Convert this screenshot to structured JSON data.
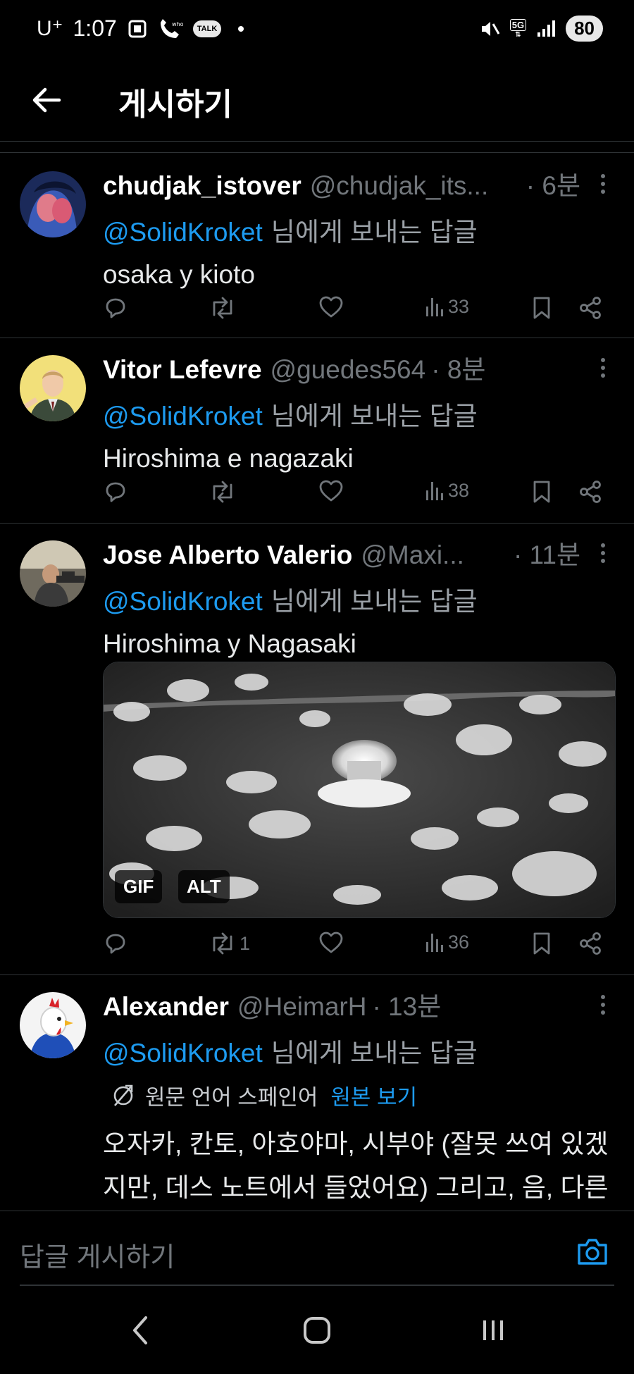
{
  "status_bar": {
    "carrier": "U⁺",
    "time": "1:07",
    "talk_label": "TALK",
    "network": "5G",
    "battery": "80"
  },
  "header": {
    "title": "게시하기"
  },
  "tweets": [
    {
      "name": "chudjak_istover",
      "handle": "@chudjak_its...",
      "time": "· 6분",
      "mention": "@SolidKroket",
      "reply_suffix": "님에게 보내는 답글",
      "text": "osaka y kioto",
      "retweets": "",
      "views": "33"
    },
    {
      "name": "Vitor Lefevre",
      "handle": "@guedes564",
      "time": "· 8분",
      "mention": "@SolidKroket",
      "reply_suffix": "님에게 보내는 답글",
      "text": "Hiroshima e nagazaki",
      "retweets": "",
      "views": "38"
    },
    {
      "name": "Jose Alberto Valerio",
      "handle": "@Maxi...",
      "time": "· 11분",
      "mention": "@SolidKroket",
      "reply_suffix": "님에게 보내는 답글",
      "text": "Hiroshima y Nagasaki",
      "media_badges": [
        "GIF",
        "ALT"
      ],
      "retweets": "1",
      "views": "36"
    },
    {
      "name": "Alexander",
      "handle": "@HeimarH",
      "time": "· 13분",
      "mention": "@SolidKroket",
      "reply_suffix": "님에게 보내는 답글",
      "translation_note": "원문 언어 스페인어",
      "translation_link": "원본 보기",
      "text": "오자카, 칸토, 아호야마, 시부야 (잘못 쓰여 있겠지만, 데스 노트에서 들었어요) 그리고, 음, 다른 두 개의 유명한 도시는 떠올리는 게",
      "views": ""
    }
  ],
  "composer": {
    "placeholder": "답글 게시하기"
  },
  "colors": {
    "accent": "#1d9bf0",
    "secondary_text": "#71767b",
    "background": "#000000"
  },
  "icons": [
    "back-arrow-icon",
    "reply-icon",
    "retweet-icon",
    "like-icon",
    "views-icon",
    "bookmark-icon",
    "share-icon",
    "more-icon",
    "camera-icon",
    "translate-icon"
  ]
}
